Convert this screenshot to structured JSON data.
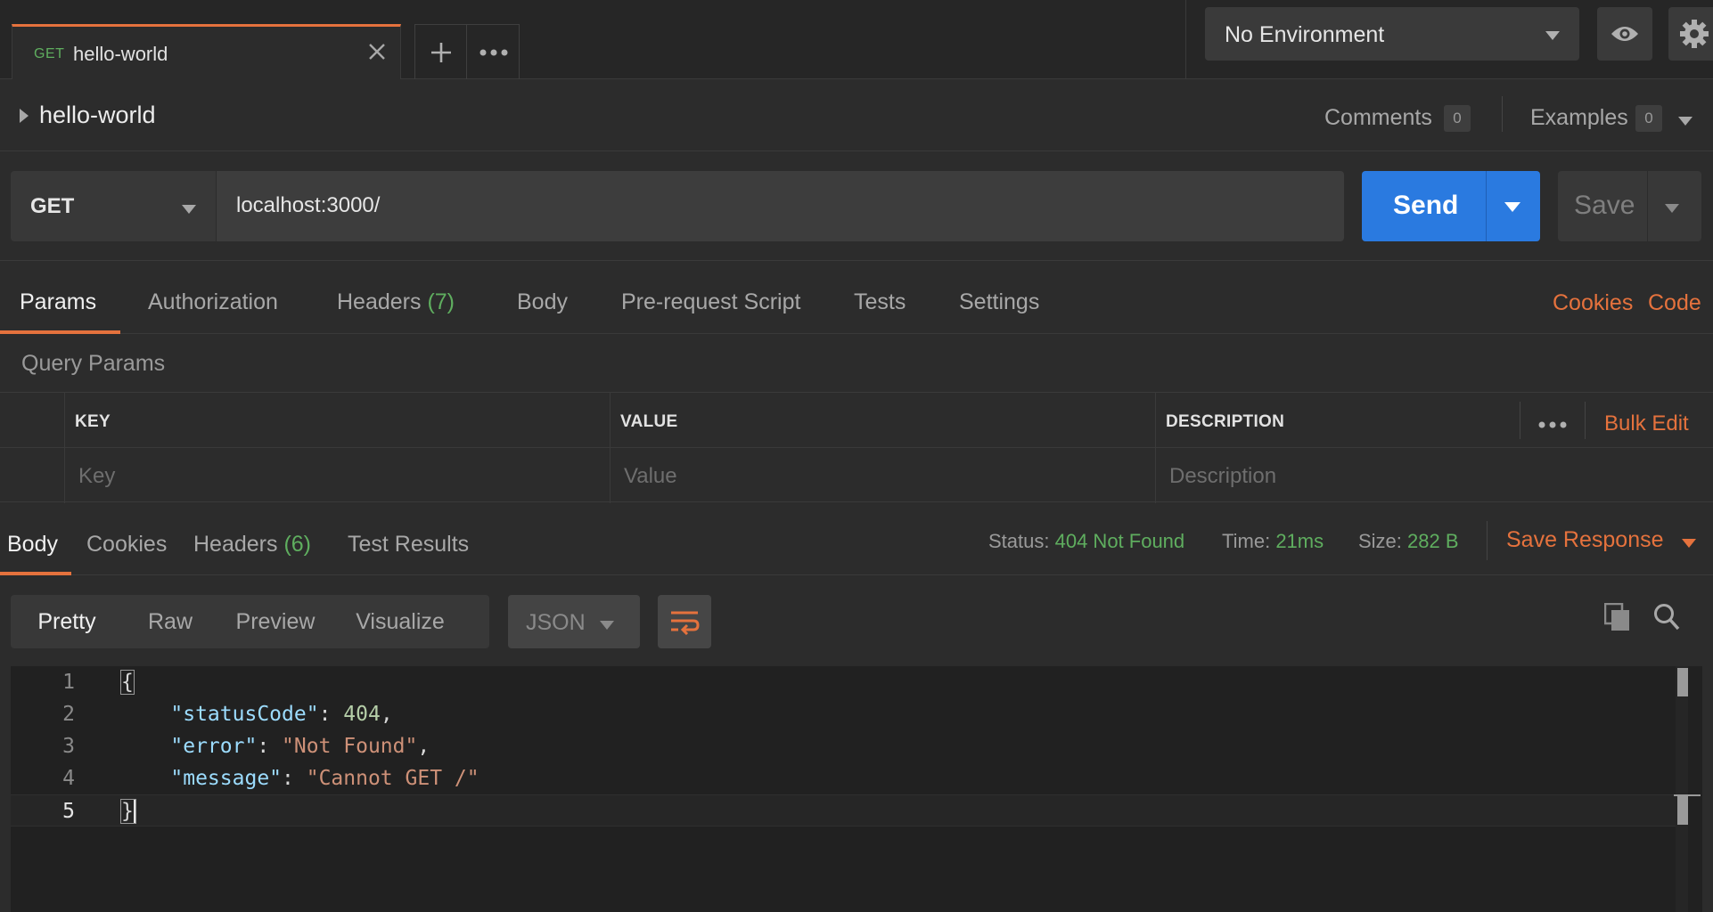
{
  "tab": {
    "method": "GET",
    "name": "hello-world"
  },
  "environment": {
    "label": "No Environment"
  },
  "request": {
    "title": "hello-world",
    "comments_label": "Comments",
    "comments_count": "0",
    "examples_label": "Examples",
    "examples_count": "0",
    "method": "GET",
    "url": "localhost:3000/",
    "send_label": "Send",
    "save_label": "Save"
  },
  "request_tabs": {
    "params": "Params",
    "authorization": "Authorization",
    "headers": "Headers",
    "headers_count": "(7)",
    "body": "Body",
    "prerequest": "Pre-request Script",
    "tests": "Tests",
    "settings": "Settings",
    "cookies": "Cookies",
    "code": "Code"
  },
  "query_params": {
    "title": "Query Params",
    "columns": [
      "KEY",
      "VALUE",
      "DESCRIPTION"
    ],
    "placeholders": [
      "Key",
      "Value",
      "Description"
    ],
    "bulk_edit": "Bulk Edit"
  },
  "response_tabs": {
    "body": "Body",
    "cookies": "Cookies",
    "headers": "Headers",
    "headers_count": "(6)",
    "test_results": "Test Results"
  },
  "response_meta": {
    "status_label": "Status:",
    "status_value": "404 Not Found",
    "time_label": "Time:",
    "time_value": "21ms",
    "size_label": "Size:",
    "size_value": "282 B",
    "save_response": "Save Response"
  },
  "viewer": {
    "modes": [
      "Pretty",
      "Raw",
      "Preview",
      "Visualize"
    ],
    "active_mode": "Pretty",
    "format": "JSON"
  },
  "code_lines": [
    {
      "n": "1",
      "open": "{"
    },
    {
      "n": "2",
      "key": "\"statusCode\"",
      "sep": ": ",
      "num": "404",
      "tail": ","
    },
    {
      "n": "3",
      "key": "\"error\"",
      "sep": ": ",
      "str": "\"Not Found\"",
      "tail": ","
    },
    {
      "n": "4",
      "key": "\"message\"",
      "sep": ": ",
      "str": "\"Cannot GET /\""
    },
    {
      "n": "5",
      "close": "}"
    }
  ],
  "colors": {
    "accent_orange": "#e5723d",
    "send_blue": "#2a7ae0",
    "success_green": "#5fae5f",
    "background": "#2c2c2c"
  }
}
